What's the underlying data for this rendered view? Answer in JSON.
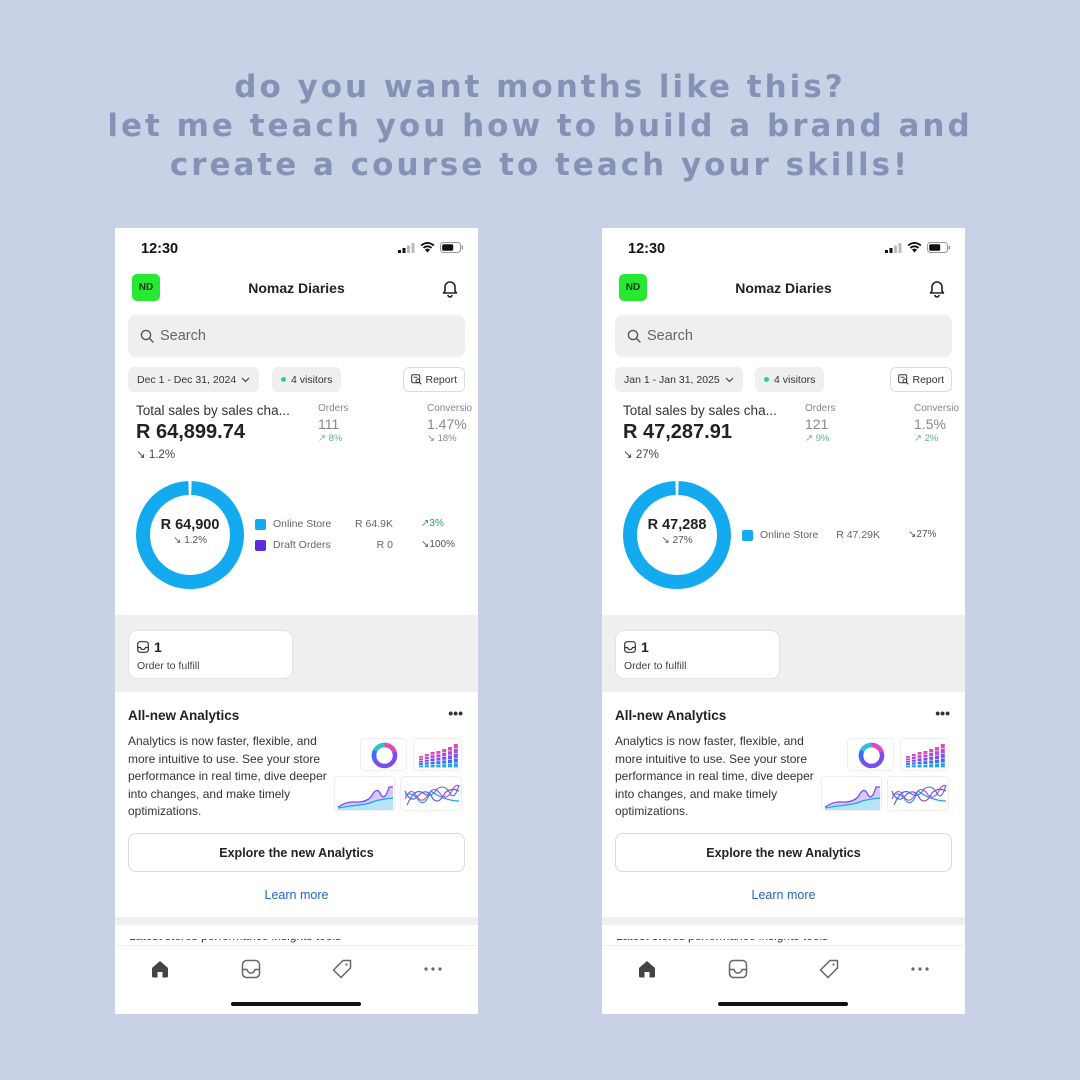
{
  "headline": {
    "lines": [
      "do you want months like this?",
      "let me teach you how to build a brand and",
      "create a course to teach your skills!"
    ],
    "color": "#8592b5"
  },
  "background_color": "#c8d1e5",
  "phones": [
    {
      "status": {
        "time": "12:30"
      },
      "header": {
        "avatar_initials": "ND",
        "store_name": "Nomaz Diaries",
        "bell_icon": "bell-icon"
      },
      "search": {
        "placeholder": "Search",
        "icon": "search-icon"
      },
      "filters": {
        "date_range": "Dec 1 - Dec 31, 2024",
        "visitors": "4 visitors",
        "report_label": "Report"
      },
      "metrics": {
        "title": "Total sales by sales cha...",
        "total": "R 64,899.74",
        "total_change": "1.2%",
        "total_change_dir": "down",
        "orders_label": "Orders",
        "orders_value": "111",
        "orders_change": "8%",
        "orders_change_dir": "up",
        "conversion_label": "Conversio",
        "conversion_value": "1.47%",
        "conversion_change": "18%",
        "conversion_change_dir": "down"
      },
      "donut": {
        "center_value": "R 64,900",
        "center_change": "1.2%",
        "center_change_dir": "down",
        "segments": [
          {
            "name": "Online Store",
            "amount": "R 64.9K",
            "change": "3%",
            "dir": "up",
            "color": "#14aaf0",
            "share": 1.0
          },
          {
            "name": "Draft Orders",
            "amount": "R 0",
            "change": "100%",
            "dir": "down",
            "color": "#5b2be0",
            "share": 0.0
          }
        ]
      },
      "fulfill": {
        "count": "1",
        "label": "Order to fulfill"
      },
      "analytics": {
        "title": "All-new Analytics",
        "more": "•••",
        "body": "Analytics is now faster, flexible, and more intuitive to use. See your store performance in real time, dive deeper into changes, and make timely optimizations.",
        "explore_label": "Explore the new Analytics",
        "learn_more_label": "Learn more"
      },
      "cut_text": "Latest stores performance insights tools",
      "tabs": [
        "home-icon",
        "orders-inbox-icon",
        "products-tag-icon",
        "more-icon"
      ]
    },
    {
      "status": {
        "time": "12:30"
      },
      "header": {
        "avatar_initials": "ND",
        "store_name": "Nomaz Diaries",
        "bell_icon": "bell-icon"
      },
      "search": {
        "placeholder": "Search",
        "icon": "search-icon"
      },
      "filters": {
        "date_range": "Jan 1 - Jan 31, 2025",
        "visitors": "4 visitors",
        "report_label": "Report"
      },
      "metrics": {
        "title": "Total sales by sales cha...",
        "total": "R 47,287.91",
        "total_change": "27%",
        "total_change_dir": "down",
        "orders_label": "Orders",
        "orders_value": "121",
        "orders_change": "9%",
        "orders_change_dir": "up",
        "conversion_label": "Conversio",
        "conversion_value": "1.5%",
        "conversion_change": "2%",
        "conversion_change_dir": "up"
      },
      "donut": {
        "center_value": "R 47,288",
        "center_change": "27%",
        "center_change_dir": "down",
        "segments": [
          {
            "name": "Online Store",
            "amount": "R 47.29K",
            "change": "27%",
            "dir": "down",
            "color": "#14aaf0",
            "share": 1.0
          }
        ]
      },
      "fulfill": {
        "count": "1",
        "label": "Order to fulfill"
      },
      "analytics": {
        "title": "All-new Analytics",
        "more": "•••",
        "body": "Analytics is now faster, flexible, and more intuitive to use. See your store performance in real time, dive deeper into changes, and make timely optimizations.",
        "explore_label": "Explore the new Analytics",
        "learn_more_label": "Learn more"
      },
      "cut_text": "Latest stores performance insights tools",
      "tabs": [
        "home-icon",
        "orders-inbox-icon",
        "products-tag-icon",
        "more-icon"
      ]
    }
  ],
  "arrows": {
    "up": "↗",
    "down": "↘"
  }
}
